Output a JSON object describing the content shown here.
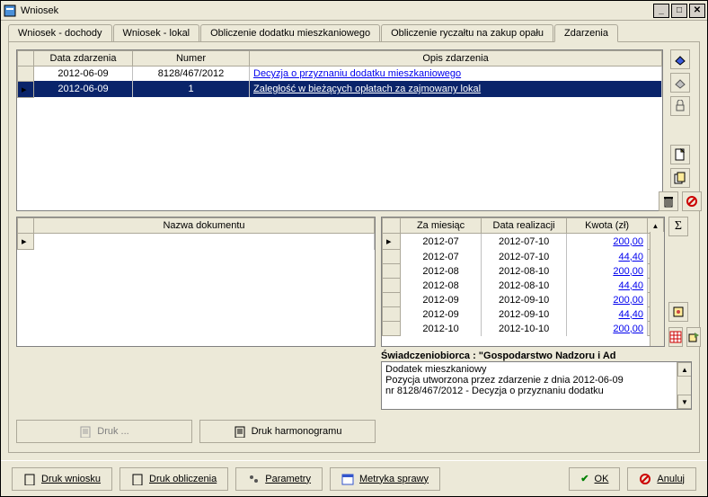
{
  "window": {
    "title": "Wniosek"
  },
  "tabs": {
    "t0": "Wniosek - dochody",
    "t1": "Wniosek - lokal",
    "t2": "Obliczenie dodatku mieszkaniowego",
    "t3": "Obliczenie ryczałtu na zakup opału",
    "t4": "Zdarzenia"
  },
  "events": {
    "col_date": "Data zdarzenia",
    "col_num": "Numer",
    "col_desc": "Opis zdarzenia",
    "rows": [
      {
        "date": "2012-06-09",
        "num": "8128/467/2012",
        "desc": "Decyzja o przyznaniu dodatku mieszkaniowego"
      },
      {
        "date": "2012-06-09",
        "num": "1",
        "desc": "Zaległość w bieżących opłatach za zajmowany lokal"
      }
    ]
  },
  "docs": {
    "col_name": "Nazwa dokumentu"
  },
  "pay": {
    "col_month": "Za miesiąc",
    "col_date": "Data realizacji",
    "col_amount": "Kwota (zł)",
    "rows": [
      {
        "m": "2012-07",
        "d": "2012-07-10",
        "a": "200,00"
      },
      {
        "m": "2012-07",
        "d": "2012-07-10",
        "a": "44,40"
      },
      {
        "m": "2012-08",
        "d": "2012-08-10",
        "a": "200,00"
      },
      {
        "m": "2012-08",
        "d": "2012-08-10",
        "a": "44,40"
      },
      {
        "m": "2012-09",
        "d": "2012-09-10",
        "a": "200,00"
      },
      {
        "m": "2012-09",
        "d": "2012-09-10",
        "a": "44,40"
      },
      {
        "m": "2012-10",
        "d": "2012-10-10",
        "a": "200,00"
      }
    ]
  },
  "info": {
    "heading": "Świadczeniobiorca : \"Gospodarstwo Nadzoru i Ad",
    "l1": "Dodatek mieszkaniowy",
    "l2": "Pozycja utworzona przez zdarzenie z dnia 2012-06-09",
    "l3": "nr 8128/467/2012 - Decyzja o przyznaniu dodatku"
  },
  "buttons": {
    "druk": "Druk ...",
    "druk_harm": "Druk harmonogramu",
    "druk_wn": "Druk wniosku",
    "druk_obl": "Druk obliczenia",
    "param": "Parametry",
    "metryka": "Metryka sprawy",
    "ok": "OK",
    "anuluj": "Anuluj"
  },
  "icons": {
    "eraser": "eraser",
    "erase2": "erase-alt",
    "lock": "lock",
    "newdoc": "new",
    "copydoc": "copy",
    "trash": "trash",
    "forbid": "forbid",
    "sum": "Σ",
    "tool1": "tool",
    "tool2": "grid",
    "tool3": "export"
  }
}
